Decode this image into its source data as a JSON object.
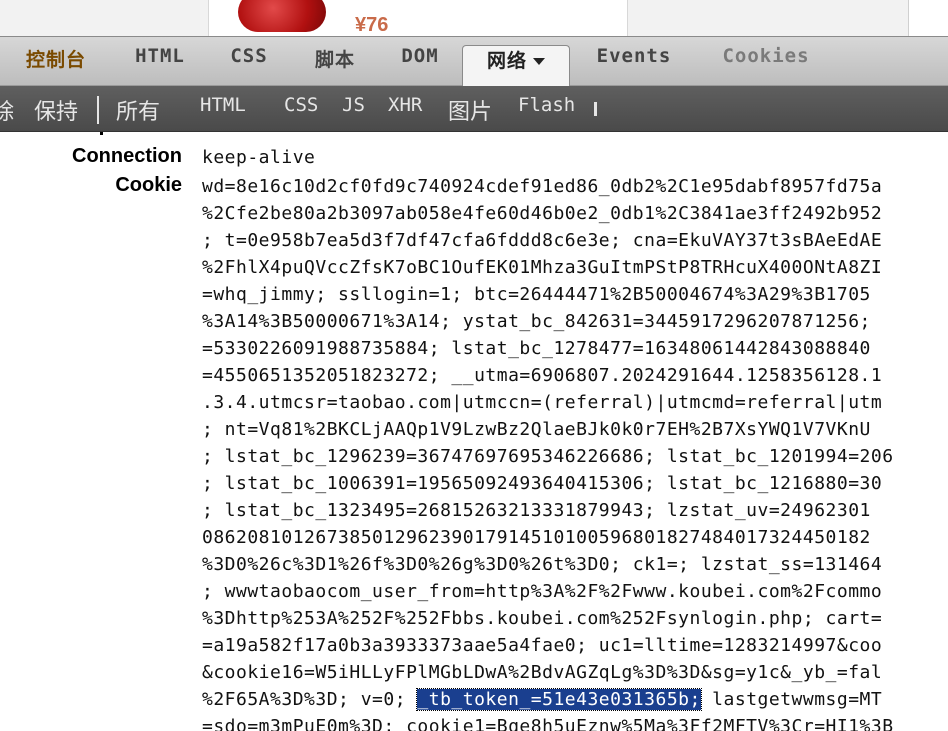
{
  "page": {
    "price_text": "¥76"
  },
  "tabs": [
    "控制台",
    "HTML",
    "CSS",
    "脚本",
    "DOM",
    "网络",
    "Events",
    "Cookies"
  ],
  "active_tab": "网络",
  "subtoolbar": {
    "clear_partial": "除",
    "persist": "保持",
    "all": "所有",
    "html": "HTML",
    "css": "CSS",
    "js": "JS",
    "xhr": "XHR",
    "images": "图片",
    "flash": "Flash"
  },
  "headers": {
    "connection_name": "Connection",
    "connection_value": "keep-alive",
    "cookie_name": "Cookie",
    "cookie_lines": [
      "wd=8e16c10d2cf0fd9c740924cdef91ed86_0db2%2C1e95dabf8957fd75a",
      "%2Cfe2be80a2b3097ab058e4fe60d46b0e2_0db1%2C3841ae3ff2492b952",
      "; t=0e958b7ea5d3f7df47cfa6fddd8c6e3e; cna=EkuVAY37t3sBAeEdAE",
      "%2FhlX4puQVccZfsK7oBC1OufEK01Mhza3GuItmPStP8TRHcuX400ONtA8ZI",
      "=whq_jimmy; ssllogin=1; btc=26444471%2B50004674%3A29%3B1705",
      "%3A14%3B50000671%3A14; ystat_bc_842631=3445917296207871256;",
      "=5330226091988735884; lstat_bc_1278477=16348061442843088840",
      "=4550651352051823272; __utma=6906807.2024291644.1258356128.1",
      ".3.4.utmcsr=taobao.com|utmccn=(referral)|utmcmd=referral|utm",
      "; nt=Vq81%2BKCLjAAQp1V9LzwBz2QlaeBJk0k0r7EH%2B7XsYWQ1V7VKnU",
      "; lstat_bc_1296239=36747697695346226686; lstat_bc_1201994=206",
      "; lstat_bc_1006391=19565092493640415306; lstat_bc_1216880=30",
      "; lstat_bc_1323495=26815263213331879943; lzstat_uv=24962301",
      "08620810126738501296239017914510100596801827484017324450182",
      "%3D0%26c%3D1%26f%3D0%26g%3D0%26t%3D0; ck1=; lzstat_ss=131464",
      "; wwwtaobaocom_user_from=http%3A%2F%2Fwww.koubei.com%2Fcommo",
      "%3Dhttp%253A%252F%252Fbbs.koubei.com%252Fsynlogin.php; cart=",
      "=a19a582f17a0b3a3933373aae5a4fae0; uc1=lltime=1283214997&coo",
      "&cookie16=W5iHLLyFPlMGbLDwA%2BdvAGZqLg%3D%3D&sg=y1c&_yb_=fal",
      "%2F65A%3D%3D; v=0; ",
      "_tb_token_=51e43e031365b;",
      " lastgetwwmsg=MT",
      "=sdo=m3mPuE0m%3D; cookie1=Bqe8h5uEznw%5Ma%3Ff2MFTV%3Cr=HI1%3B"
    ]
  }
}
